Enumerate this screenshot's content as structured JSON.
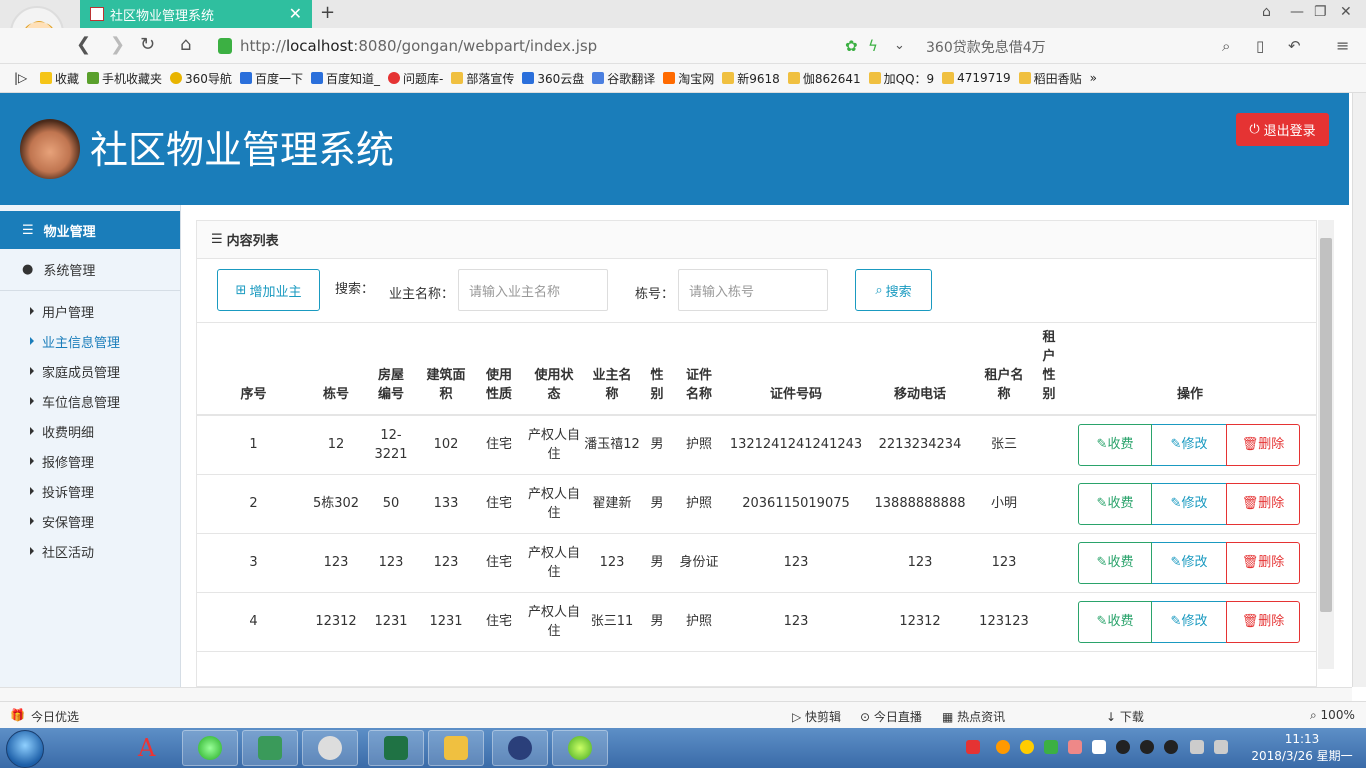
{
  "browser": {
    "tab_title": "社区物业管理系统",
    "url_host": "localhost",
    "url_rest": ":8080/gongan/webpart/index.jsp",
    "url_scheme": "http://",
    "ad_text": "360贷款免息借4万",
    "bookmarks": [
      "收藏",
      "手机收藏夹",
      "360导航",
      "百度一下",
      "百度知道_",
      "问题库-",
      "部落宣传",
      "360云盘",
      "谷歌翻译",
      "淘宝网",
      "新9618",
      "伽862641",
      "加QQ：9",
      "4719719",
      "稻田香贴"
    ]
  },
  "header": {
    "system_name": "社区物业管理系统",
    "logout_label": "退出登录"
  },
  "sidebar": {
    "section_property": "物业管理",
    "section_system": "系统管理",
    "items": [
      {
        "label": "用户管理",
        "active": false
      },
      {
        "label": "业主信息管理",
        "active": true
      },
      {
        "label": "家庭成员管理",
        "active": false
      },
      {
        "label": "车位信息管理",
        "active": false
      },
      {
        "label": "收费明细",
        "active": false
      },
      {
        "label": "报修管理",
        "active": false
      },
      {
        "label": "投诉管理",
        "active": false
      },
      {
        "label": "安保管理",
        "active": false
      },
      {
        "label": "社区活动",
        "active": false
      }
    ]
  },
  "content": {
    "panel_title": "内容列表",
    "add_owner_label": "增加业主",
    "search_label": "搜索：",
    "owner_name_label": "业主名称：",
    "owner_name_placeholder": "请输入业主名称",
    "building_label": "栋号：",
    "building_placeholder": "请输入栋号",
    "search_button": "搜索"
  },
  "table": {
    "headers": [
      "序号",
      "栋号",
      "房屋编号",
      "建筑面积",
      "使用性质",
      "使用状态",
      "业主名称",
      "性别",
      "证件名称",
      "证件号码",
      "移动电话",
      "租户名称",
      "租户性别",
      "操作"
    ],
    "rows": [
      [
        "1",
        "12",
        "12-3221",
        "102",
        "住宅",
        "产权人自住",
        "潘玉禧12",
        "男",
        "护照",
        "1321241241241243",
        "2213234234",
        "张三",
        ""
      ],
      [
        "2",
        "5栋302",
        "50",
        "133",
        "住宅",
        "产权人自住",
        "翟建新",
        "男",
        "护照",
        "2036115019075",
        "13888888888",
        "小明",
        ""
      ],
      [
        "3",
        "123",
        "123",
        "123",
        "住宅",
        "产权人自住",
        "123",
        "男",
        "身份证",
        "123",
        "123",
        "123",
        ""
      ],
      [
        "4",
        "12312",
        "1231",
        "1231",
        "住宅",
        "产权人自住",
        "张三11",
        "男",
        "护照",
        "123",
        "12312",
        "123123",
        ""
      ]
    ],
    "op_fee": "收费",
    "op_edit": "修改",
    "op_delete": "删除"
  },
  "statusbar": {
    "left": "今日优选",
    "items": [
      "快剪辑",
      "今日直播",
      "热点资讯",
      "下载"
    ],
    "zoom": "100%"
  },
  "taskbar": {
    "time": "11:13",
    "date": "2018/3/26 星期一"
  },
  "colors": {
    "primary": "#1a7dba",
    "danger": "#e53333",
    "success": "#2aa36b",
    "tab": "#2fbf9f"
  }
}
